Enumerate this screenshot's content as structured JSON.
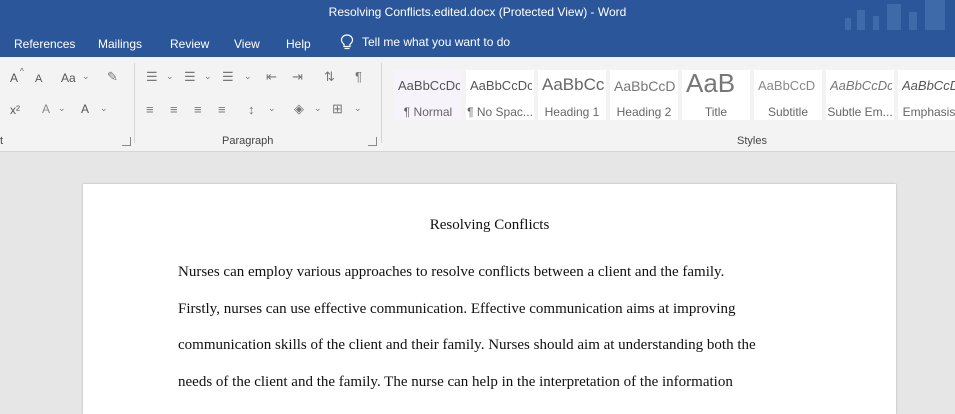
{
  "titlebar": {
    "title": "Resolving Conflicts.edited.docx (Protected View)  -  Word"
  },
  "menu": {
    "items": [
      "References",
      "Mailings",
      "Review",
      "View",
      "Help"
    ],
    "tellme": "Tell me what you want to do"
  },
  "ribbon": {
    "font_buttons": {
      "grow": "A",
      "shrink": "A",
      "case": "Aa",
      "superscript": "x²",
      "effects": "A",
      "color": "A"
    },
    "paragraph_label": "Paragraph",
    "styles_label": "Styles",
    "font_label_partial": "t"
  },
  "styles": [
    {
      "preview": "AaBbCcDc",
      "name": "¶ Normal"
    },
    {
      "preview": "AaBbCcDc",
      "name": "¶ No Spac..."
    },
    {
      "preview": "AaBbCc",
      "name": "Heading 1"
    },
    {
      "preview": "AaBbCcD",
      "name": "Heading 2"
    },
    {
      "preview": "AaB",
      "name": "Title"
    },
    {
      "preview": "AaBbCcD",
      "name": "Subtitle"
    },
    {
      "preview": "AaBbCcDc",
      "name": "Subtle Em..."
    },
    {
      "preview": "AaBbCcDc",
      "name": "Emphasis"
    }
  ],
  "document": {
    "title": "Resolving Conflicts",
    "lines": [
      "Nurses can employ various approaches to resolve conflicts between a client and the family.",
      "Firstly, nurses can use effective communication. Effective communication aims at improving",
      "communication skills of the client and their family. Nurses should aim at understanding both the",
      "needs of the client and the family. The nurse can help in the interpretation of the information"
    ]
  }
}
